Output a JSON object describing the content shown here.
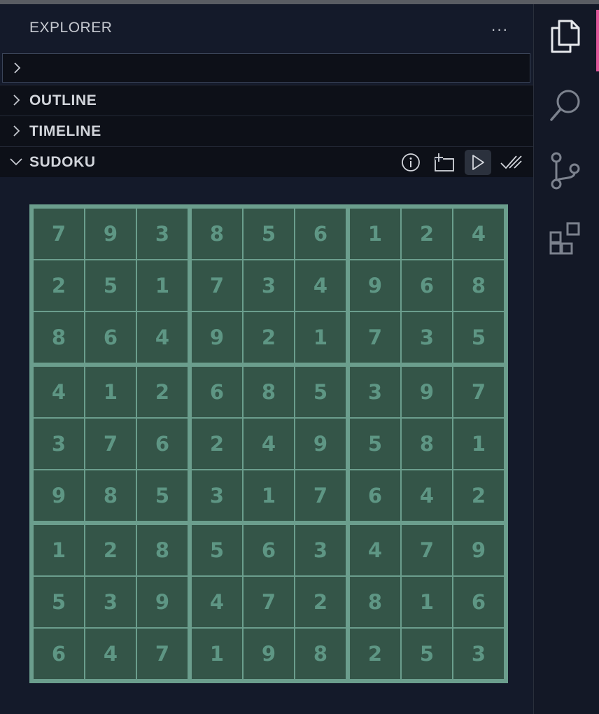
{
  "explorer": {
    "title": "EXPLORER",
    "more_label": "···"
  },
  "sections": {
    "outline": "OUTLINE",
    "timeline": "TIMELINE",
    "sudoku": "SUDOKU"
  },
  "sudoku_toolbar": [
    "info-icon",
    "new-game-icon",
    "play-icon",
    "check-all-icon"
  ],
  "activity_bar": [
    "explorer-icon",
    "search-icon",
    "source-control-icon",
    "extensions-icon"
  ],
  "colors": {
    "accent": "#e0579a",
    "board_grid": "#6b9e8d",
    "cell_bg": "#345548",
    "cell_text": "#5e9684"
  },
  "board": [
    [
      7,
      9,
      3,
      8,
      5,
      6,
      1,
      2,
      4
    ],
    [
      2,
      5,
      1,
      7,
      3,
      4,
      9,
      6,
      8
    ],
    [
      8,
      6,
      4,
      9,
      2,
      1,
      7,
      3,
      5
    ],
    [
      4,
      1,
      2,
      6,
      8,
      5,
      3,
      9,
      7
    ],
    [
      3,
      7,
      6,
      2,
      4,
      9,
      5,
      8,
      1
    ],
    [
      9,
      8,
      5,
      3,
      1,
      7,
      6,
      4,
      2
    ],
    [
      1,
      2,
      8,
      5,
      6,
      3,
      4,
      7,
      9
    ],
    [
      5,
      3,
      9,
      4,
      7,
      2,
      8,
      1,
      6
    ],
    [
      6,
      4,
      7,
      1,
      9,
      8,
      2,
      5,
      3
    ]
  ]
}
